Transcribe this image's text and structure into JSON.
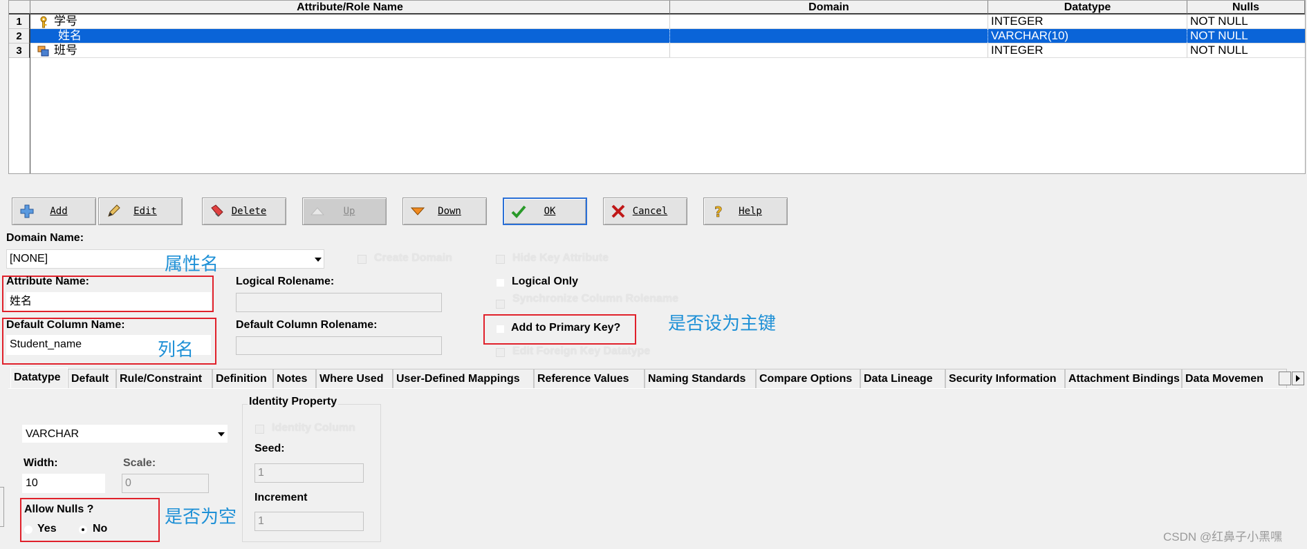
{
  "grid": {
    "columns": [
      "Attribute/Role Name",
      "Domain",
      "Datatype",
      "Nulls"
    ],
    "rows": [
      {
        "num": "1",
        "name": "学号",
        "domain": "",
        "datatype": "INTEGER",
        "nulls": "NOT NULL",
        "icon": "primary-key-icon",
        "selected": false
      },
      {
        "num": "2",
        "name": "姓名",
        "domain": "",
        "datatype": "VARCHAR(10)",
        "nulls": "NOT NULL",
        "icon": "",
        "selected": true
      },
      {
        "num": "3",
        "name": "班号",
        "domain": "",
        "datatype": "INTEGER",
        "nulls": "NOT NULL",
        "icon": "foreign-key-icon",
        "selected": false
      }
    ]
  },
  "toolbar": {
    "add": "Add",
    "edit": "Edit",
    "delete": "Delete",
    "up": "Up",
    "down": "Down",
    "ok": "OK",
    "cancel": "Cancel",
    "help": "Help"
  },
  "form": {
    "domain_label": "Domain Name:",
    "domain_value": "[NONE]",
    "create_domain": "Create Domain",
    "hide_key_attribute": "Hide Key Attribute",
    "attribute_name_label": "Attribute Name:",
    "attribute_name_value": "姓名",
    "logical_rolename_label": "Logical Rolename:",
    "logical_only": "Logical Only",
    "sync_rolename": "Synchronize Column Rolename",
    "default_column_label": "Default Column Name:",
    "default_column_value": "Student_name",
    "default_column_rolename_label": "Default Column Rolename:",
    "add_to_pk": "Add to Primary Key?",
    "edit_fk_datatype": "Edit Foreign Key Datatype"
  },
  "annotations": {
    "attr_name": "属性名",
    "col_name": "列名",
    "pk": "是否设为主键",
    "nulls": "是否为空"
  },
  "tabs": [
    "Datatype",
    "Default",
    "Rule/Constraint",
    "Definition",
    "Notes",
    "Where Used",
    "User-Defined Mappings",
    "Reference Values",
    "Naming Standards",
    "Compare Options",
    "Data Lineage",
    "Security Information",
    "Attachment Bindings",
    "Data Movemen"
  ],
  "datatype": {
    "type_value": "VARCHAR",
    "width_label": "Width:",
    "width_value": "10",
    "scale_label": "Scale:",
    "scale_value": "0",
    "allow_nulls_label": "Allow Nulls ?",
    "yes": "Yes",
    "no": "No",
    "allow_nulls_selected": "No"
  },
  "identity": {
    "title": "Identity Property",
    "identity_column": "Identity Column",
    "seed_label": "Seed:",
    "seed_value": "1",
    "increment_label": "Increment",
    "increment_value": "1"
  },
  "watermark": "CSDN @红鼻子小黑嘿",
  "colors": {
    "selection": "#0a64d8",
    "annotation_box": "#e0202a",
    "annotation_text": "#1e90d6"
  }
}
